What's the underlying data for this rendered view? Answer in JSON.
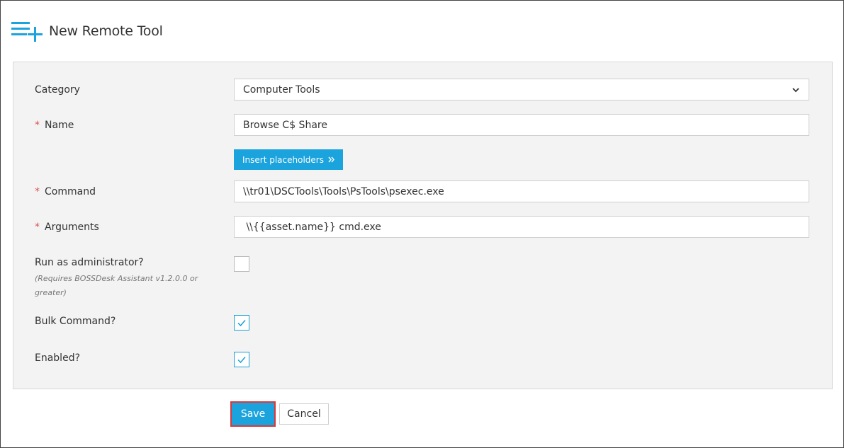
{
  "page": {
    "title": "New Remote Tool",
    "icon": "add-list-icon",
    "accent_color": "#1aa3dc",
    "required_marker": "*",
    "required_color": "#d9534f"
  },
  "form": {
    "category": {
      "label": "Category",
      "value": "Computer Tools"
    },
    "name": {
      "label": "Name",
      "value": "Browse C$ Share"
    },
    "insert_placeholders": {
      "label": "Insert placeholders",
      "icon": "double-chevron-right-icon"
    },
    "command": {
      "label": "Command",
      "value": "\\\\tr01\\DSCTools\\Tools\\PsTools\\psexec.exe"
    },
    "arguments": {
      "label": "Arguments",
      "value": " \\\\{{asset.name}} cmd.exe"
    },
    "run_as_admin": {
      "label": "Run as administrator?",
      "note": "(Requires BOSSDesk Assistant v1.2.0.0 or greater)",
      "checked": false
    },
    "bulk_command": {
      "label": "Bulk Command?",
      "checked": true
    },
    "enabled": {
      "label": "Enabled?",
      "checked": true
    }
  },
  "actions": {
    "save_label": "Save",
    "cancel_label": "Cancel"
  }
}
